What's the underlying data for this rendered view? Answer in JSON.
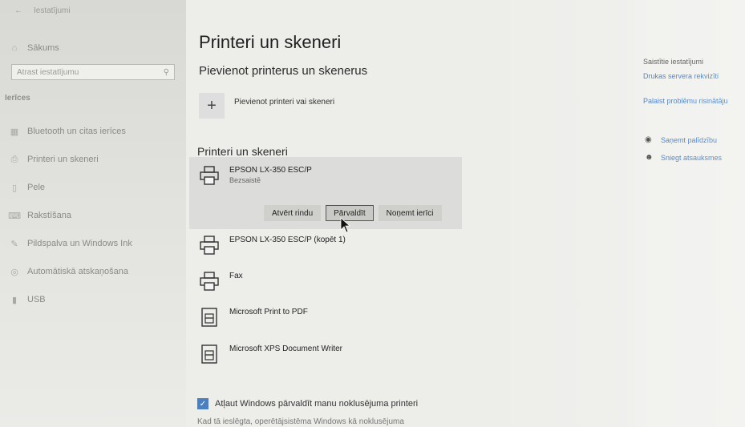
{
  "sidebar": {
    "back_icon": "back-arrow-icon",
    "window_title": "Iestatījumi",
    "home_label": "Sākums",
    "search_placeholder": "Atrast iestatījumu",
    "section_title": "Ierīces",
    "items": [
      {
        "label": "Bluetooth un citas ierīces",
        "icon": "bluetooth-devices-icon"
      },
      {
        "label": "Printeri un skeneri",
        "icon": "printer-icon"
      },
      {
        "label": "Pele",
        "icon": "mouse-icon"
      },
      {
        "label": "Rakstīšana",
        "icon": "keyboard-icon"
      },
      {
        "label": "Pildspalva un Windows Ink",
        "icon": "pen-icon"
      },
      {
        "label": "Automātiskā atskaņošana",
        "icon": "autoplay-icon"
      },
      {
        "label": "USB",
        "icon": "usb-icon"
      }
    ]
  },
  "main": {
    "title": "Printeri un skeneri",
    "add_section_title": "Pievienot printerus un skenerus",
    "add_button_label": "Pievienot printeri vai skeneri",
    "list_title": "Printeri un skeneri",
    "printers": [
      {
        "name": "EPSON LX-350 ESC/P",
        "status": "Bezsaistē"
      },
      {
        "name": "EPSON LX-350 ESC/P (kopēt 1)"
      },
      {
        "name": "Fax"
      },
      {
        "name": "Microsoft Print to PDF"
      },
      {
        "name": "Microsoft XPS Document Writer"
      }
    ],
    "actions": {
      "open_queue": "Atvērt rindu",
      "manage": "Pārvaldīt",
      "remove": "Noņemt ierīci"
    },
    "default_checkbox_label": "Atļaut Windows pārvaldīt manu noklusējuma printeri",
    "default_checkbox_checked": true,
    "bottom_text": "Kad tā ieslēgta, operētājsistēma Windows kā noklusējuma"
  },
  "related": {
    "title": "Saistītie iestatījumi",
    "links": [
      "Drukas servera rekvizīti",
      "Palaist problēmu risinātāju"
    ],
    "help": [
      {
        "label": "Saņemt palīdzību",
        "icon": "help-chat-icon"
      },
      {
        "label": "Sniegt atsauksmes",
        "icon": "feedback-icon"
      }
    ]
  },
  "colors": {
    "accent": "#2e6fbf",
    "checkbox": "#4a7fc0"
  }
}
